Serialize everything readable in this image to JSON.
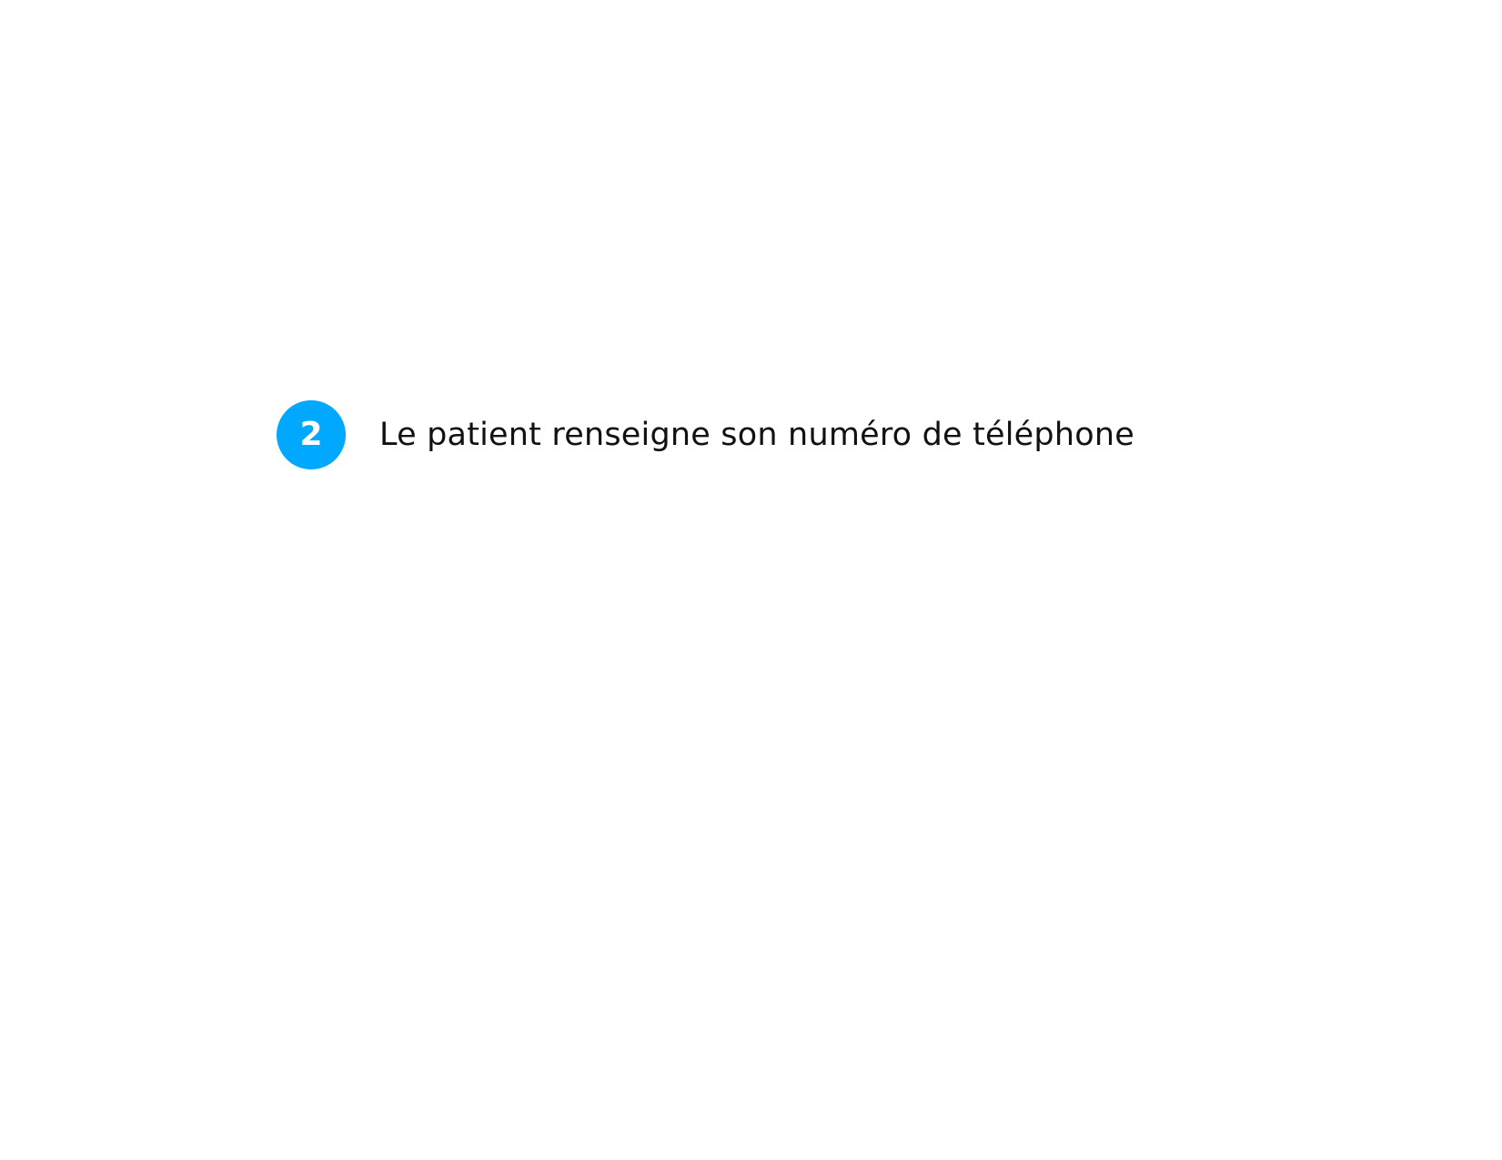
{
  "step": {
    "number": "2",
    "text": "Le patient renseigne son numéro de téléphone"
  },
  "colors": {
    "badge_background": "#00a9ff",
    "badge_text": "#ffffff",
    "text": "#111111",
    "background": "#ffffff"
  }
}
